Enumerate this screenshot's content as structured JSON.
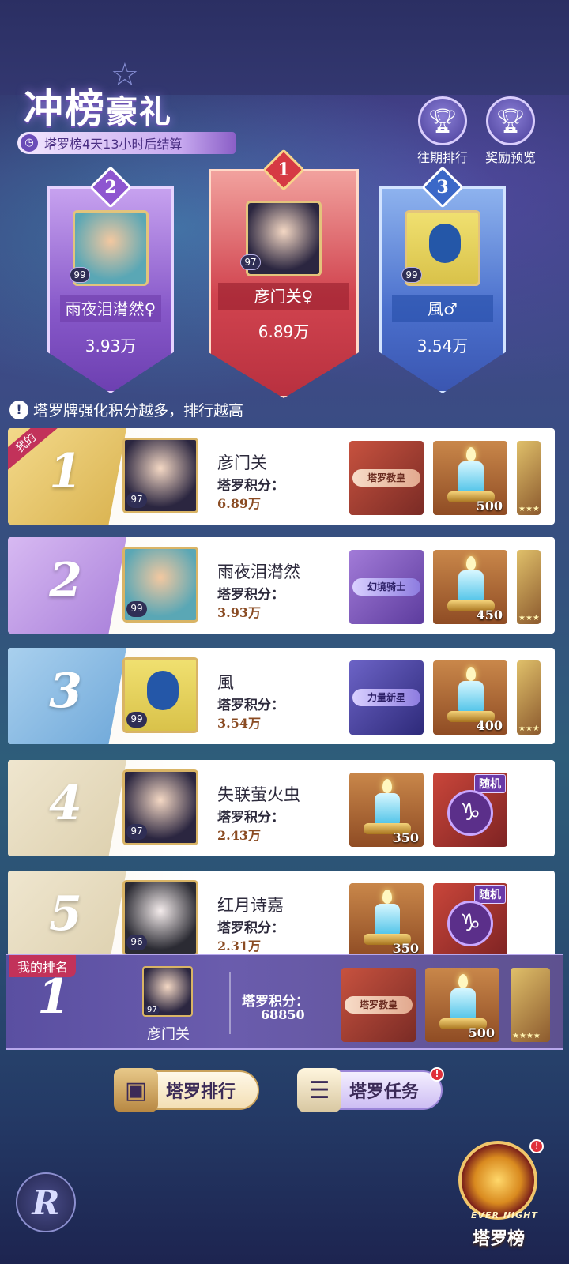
{
  "header": {
    "title_part1": "冲榜",
    "title_part2": "豪礼",
    "countdown": "塔罗榜4天13小时后结算",
    "history_label": "往期排行",
    "rewards_preview_label": "奖励预览"
  },
  "podium": [
    {
      "rank": "2",
      "level": "99",
      "name": "雨夜泪潸然♀",
      "score": "3.93万"
    },
    {
      "rank": "1",
      "level": "97",
      "name": "彦门关♀",
      "score": "6.89万"
    },
    {
      "rank": "3",
      "level": "99",
      "name": "風♂",
      "score": "3.54万"
    }
  ],
  "hint": "塔罗牌强化积分越多，排行越高",
  "score_label": "塔罗积分：",
  "mine_tag": "我的",
  "rows": [
    {
      "rank": "1",
      "level": "97",
      "name": "彦门关",
      "score": "6.89万",
      "title_reward": "塔罗教皇",
      "candle_qty": "500"
    },
    {
      "rank": "2",
      "level": "99",
      "name": "雨夜泪潸然",
      "score": "3.93万",
      "title_reward": "幻境骑士",
      "candle_qty": "450"
    },
    {
      "rank": "3",
      "level": "99",
      "name": "風",
      "score": "3.54万",
      "title_reward": "力量新星",
      "candle_qty": "400"
    },
    {
      "rank": "4",
      "level": "97",
      "name": "失联萤火虫",
      "score": "2.43万",
      "candle_qty": "350",
      "random_tag": "随机"
    },
    {
      "rank": "5",
      "level": "96",
      "name": "红月诗嘉",
      "score": "2.31万",
      "candle_qty": "350",
      "random_tag": "随机"
    }
  ],
  "my_rank": {
    "tag": "我的排名",
    "rank": "1",
    "level": "97",
    "name": "彦门关",
    "score_label": "塔罗积分：",
    "score": "68850",
    "title_reward": "塔罗教皇",
    "candle_qty": "500"
  },
  "buttons": {
    "tarot_rank": "塔罗排行",
    "tarot_task": "塔罗任务",
    "tarot_board_en": "EVER NIGHT",
    "tarot_board": "塔罗榜",
    "badge": "!"
  },
  "colors": {
    "gold": "#d9b465",
    "rank1": "#e8c66a",
    "rank2": "#b98ae0",
    "rank3": "#6fb0e0",
    "rank_other": "#e8ddc4"
  }
}
